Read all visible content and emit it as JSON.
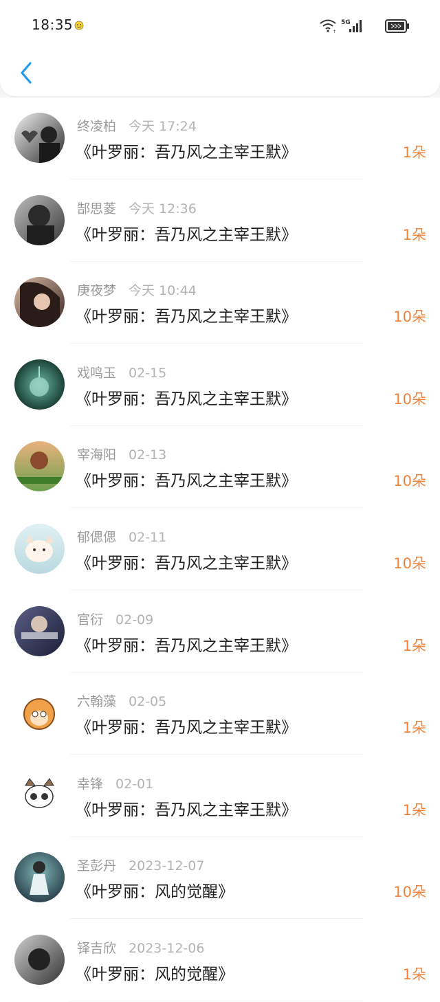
{
  "status_bar": {
    "time": "18:35",
    "network_label": "5G",
    "icons": [
      "emoji-icon",
      "wifi-icon",
      "signal-icon",
      "battery-icon"
    ]
  },
  "header": {
    "back_icon": "chevron-left-icon"
  },
  "colors": {
    "accent_blue": "#1e9bf0",
    "amount_orange": "#f0843c",
    "name_gray": "#9a9a9a",
    "title_black": "#222222"
  },
  "records": [
    {
      "name": "终凌柏",
      "date": "今天 17:24",
      "book": "《叶罗丽：吾乃风之主宰王默》",
      "amount": "1朵"
    },
    {
      "name": "郜思菱",
      "date": "今天 12:36",
      "book": "《叶罗丽：吾乃风之主宰王默》",
      "amount": "1朵"
    },
    {
      "name": "庚夜梦",
      "date": "今天 10:44",
      "book": "《叶罗丽：吾乃风之主宰王默》",
      "amount": "10朵"
    },
    {
      "name": "戏鸣玉",
      "date": "02-15",
      "book": "《叶罗丽：吾乃风之主宰王默》",
      "amount": "10朵"
    },
    {
      "name": "宰海阳",
      "date": "02-13",
      "book": "《叶罗丽：吾乃风之主宰王默》",
      "amount": "10朵"
    },
    {
      "name": "郁偲偲",
      "date": "02-11",
      "book": "《叶罗丽：吾乃风之主宰王默》",
      "amount": "10朵"
    },
    {
      "name": "官衍",
      "date": "02-09",
      "book": "《叶罗丽：吾乃风之主宰王默》",
      "amount": "1朵"
    },
    {
      "name": "六翰藻",
      "date": "02-05",
      "book": "《叶罗丽：吾乃风之主宰王默》",
      "amount": "1朵"
    },
    {
      "name": "幸锋",
      "date": "02-01",
      "book": "《叶罗丽：吾乃风之主宰王默》",
      "amount": "1朵"
    },
    {
      "name": "圣彭丹",
      "date": "2023-12-07",
      "book": "《叶罗丽：风的觉醒》",
      "amount": "10朵"
    },
    {
      "name": "铎吉欣",
      "date": "2023-12-06",
      "book": "《叶罗丽：风的觉醒》",
      "amount": "1朵"
    }
  ]
}
